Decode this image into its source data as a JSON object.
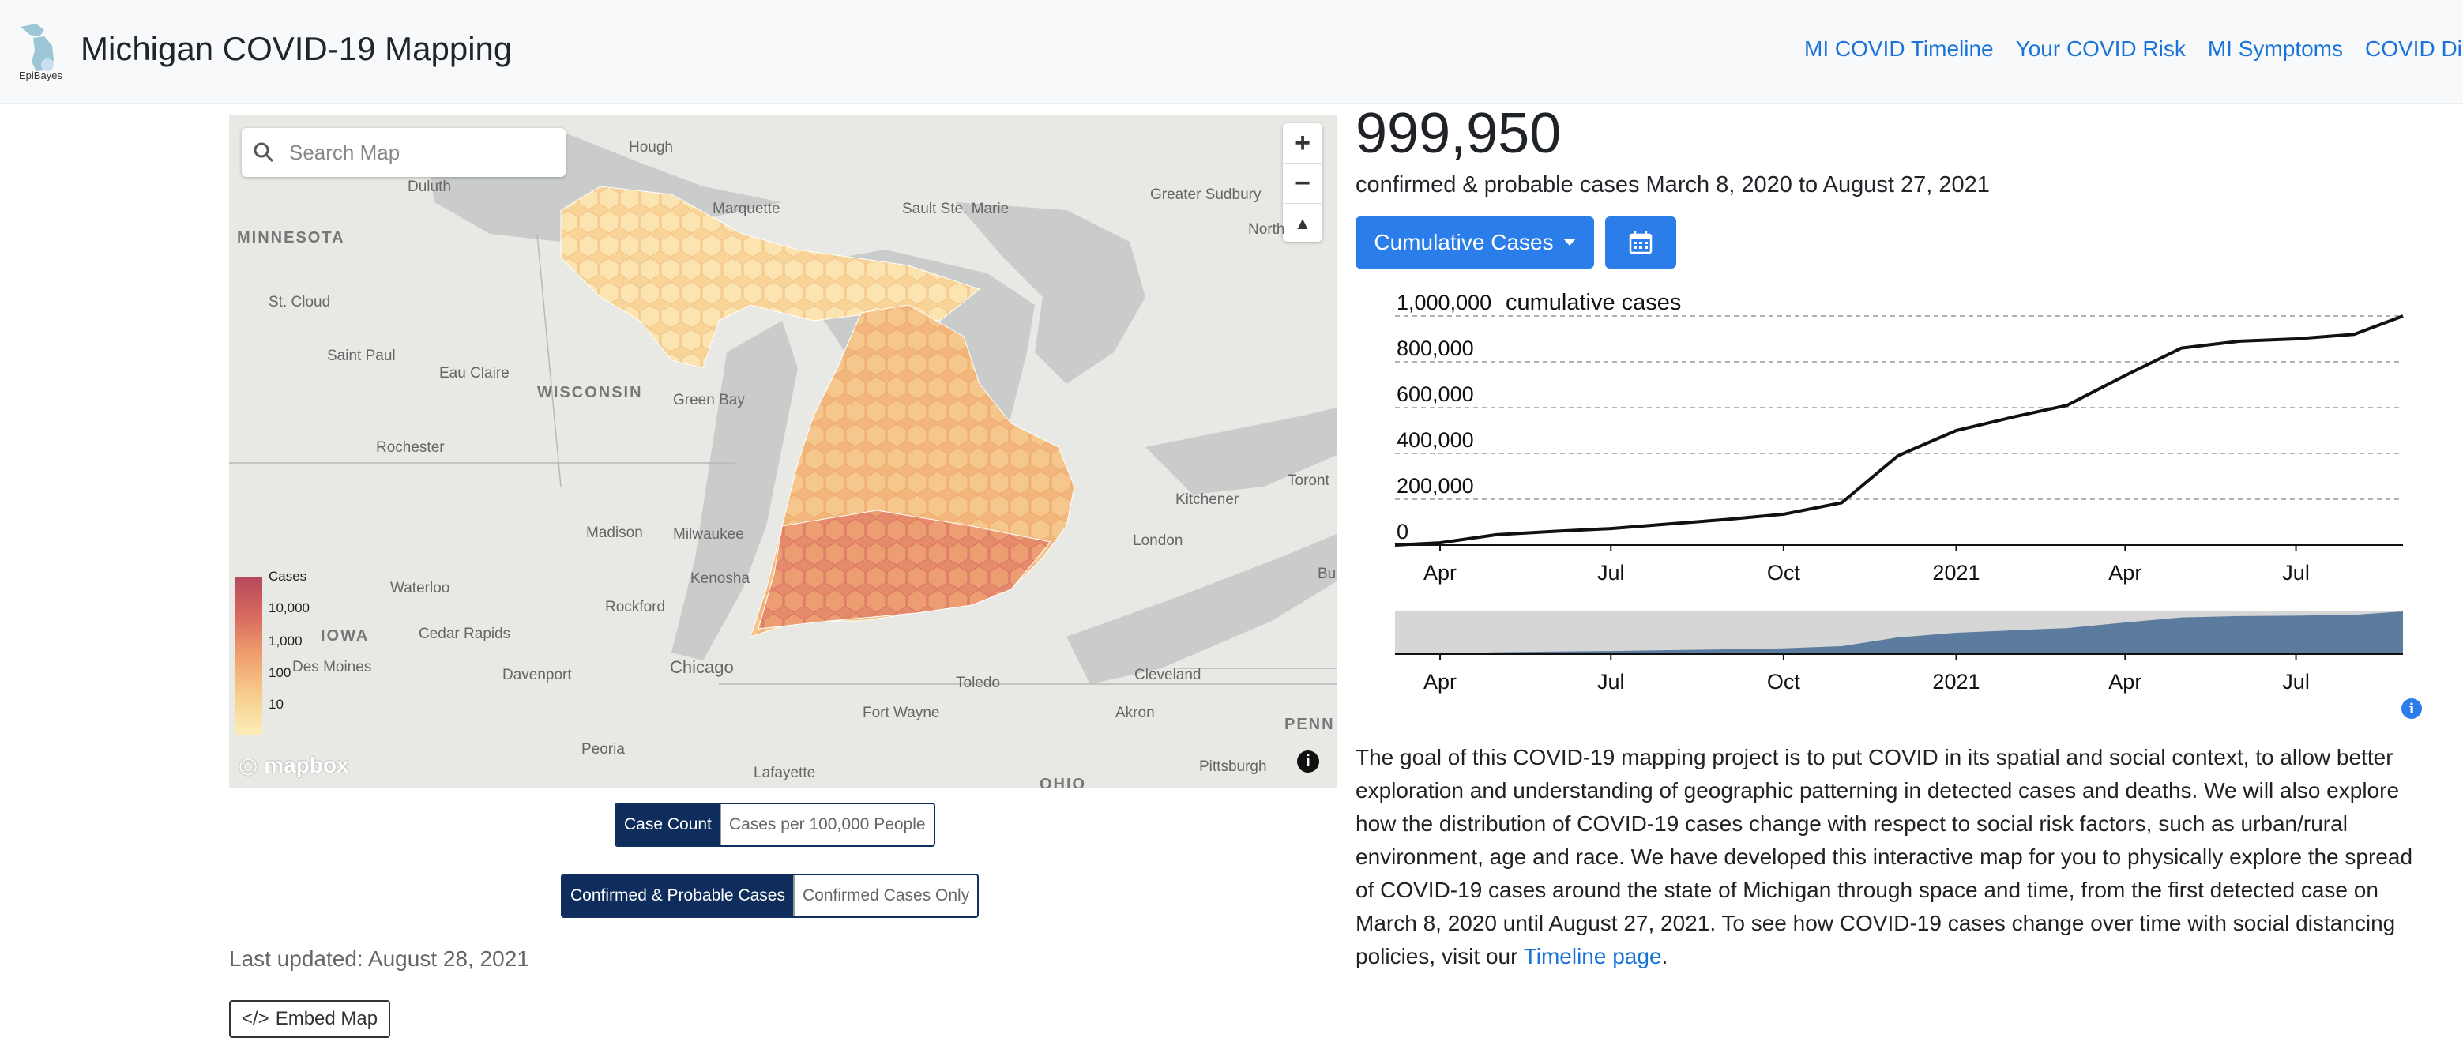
{
  "header": {
    "logo_text": "EpiBayes",
    "title": "Michigan COVID-19 Mapping",
    "nav": [
      "MI COVID Timeline",
      "Your COVID Risk",
      "MI Symptoms",
      "COVID Disp"
    ]
  },
  "map": {
    "search_placeholder": "Search Map",
    "zoom_in": "+",
    "zoom_out": "−",
    "compass": "▲",
    "places": {
      "minnesota": "MINNESOTA",
      "wisconsin": "WISCONSIN",
      "iowa": "IOWA",
      "ohio": "OHIO",
      "penn": "PENN",
      "duluth": "Duluth",
      "houghton": "Hough",
      "marquette": "Marquette",
      "sault": "Sault Ste. Marie",
      "greater_sudbury": "Greater Sudbury",
      "north": "North",
      "st_cloud": "St. Cloud",
      "saint_paul": "Saint Paul",
      "eau_claire": "Eau Claire",
      "green_bay": "Green Bay",
      "rochester": "Rochester",
      "madison": "Madison",
      "milwaukee": "Milwaukee",
      "kenosha": "Kenosha",
      "waterloo": "Waterloo",
      "rockford": "Rockford",
      "cedar_rapids": "Cedar Rapids",
      "davenport": "Davenport",
      "des_moines": "Des Moines",
      "chicago": "Chicago",
      "peoria": "Peoria",
      "fort_wayne": "Fort Wayne",
      "toledo": "Toledo",
      "lafayette": "Lafayette",
      "kitchener": "Kitchener",
      "toronto": "Toront",
      "london": "London",
      "cleveland": "Cleveland",
      "akron": "Akron",
      "pittsburgh": "Pittsburgh",
      "bu": "Bu"
    },
    "legend": {
      "title": "Cases",
      "labels": [
        "10,000",
        "1,000",
        "100",
        "10"
      ]
    },
    "attribution": "mapbox",
    "info_label": "i"
  },
  "toggles": {
    "metric": [
      "Case Count",
      "Cases per 100,000 People"
    ],
    "case_type": [
      "Confirmed & Probable Cases",
      "Confirmed Cases Only"
    ]
  },
  "last_updated": "Last updated: August 28, 2021",
  "embed_label": "Embed Map",
  "summary": {
    "total": "999,950",
    "subtitle": "confirmed & probable cases March 8, 2020 to August 27, 2021",
    "dropdown_label": "Cumulative Cases",
    "info_label": "i"
  },
  "colors": {
    "brand_blue": "#2b7de9",
    "navy": "#0e2d5c",
    "brush_fill": "#5b7c9f",
    "hex_low": "#fbeeb8",
    "hex_high": "#b5485b"
  },
  "chart_data": {
    "type": "line",
    "title": "cumulative cases",
    "x_tick_labels": [
      "Apr",
      "Jul",
      "Oct",
      "2021",
      "Apr",
      "Jul"
    ],
    "x_ticks": [
      "2020-04-01",
      "2020-07-01",
      "2020-10-01",
      "2021-01-01",
      "2021-04-01",
      "2021-07-01"
    ],
    "y_tick_labels": [
      "0",
      "200,000",
      "400,000",
      "600,000",
      "800,000",
      "1,000,000"
    ],
    "ylim": [
      0,
      1000000
    ],
    "xlim": [
      "2020-03-08",
      "2021-08-27"
    ],
    "grid": true,
    "series": [
      {
        "values": [
          [
            "2020-03-08",
            0
          ],
          [
            "2020-04-01",
            10000
          ],
          [
            "2020-05-01",
            45000
          ],
          [
            "2020-06-01",
            60000
          ],
          [
            "2020-07-01",
            72000
          ],
          [
            "2020-08-01",
            92000
          ],
          [
            "2020-09-01",
            112000
          ],
          [
            "2020-10-01",
            135000
          ],
          [
            "2020-11-01",
            185000
          ],
          [
            "2020-12-01",
            390000
          ],
          [
            "2021-01-01",
            500000
          ],
          [
            "2021-02-01",
            560000
          ],
          [
            "2021-03-01",
            610000
          ],
          [
            "2021-04-01",
            740000
          ],
          [
            "2021-05-01",
            860000
          ],
          [
            "2021-06-01",
            890000
          ],
          [
            "2021-07-01",
            900000
          ],
          [
            "2021-08-01",
            920000
          ],
          [
            "2021-08-27",
            999950
          ]
        ]
      }
    ],
    "brush": {
      "x_tick_labels": [
        "Apr",
        "Jul",
        "Oct",
        "2021",
        "Apr",
        "Jul"
      ]
    }
  },
  "description": {
    "text": "The goal of this COVID-19 mapping project is to put COVID in its spatial and social context, to allow better exploration and understanding of geographic patterning in detected cases and deaths. We will also explore how the distribution of COVID-19 cases change with respect to social risk factors, such as urban/rural environment, age and race. We have developed this interactive map for you to physically explore the spread of COVID-19 cases around the state of Michigan through space and time, from the first detected case on March 8, 2020 until August 27, 2021. To see how COVID-19 cases change over time with social distancing policies, visit our ",
    "link": "Timeline page",
    "end": "."
  }
}
